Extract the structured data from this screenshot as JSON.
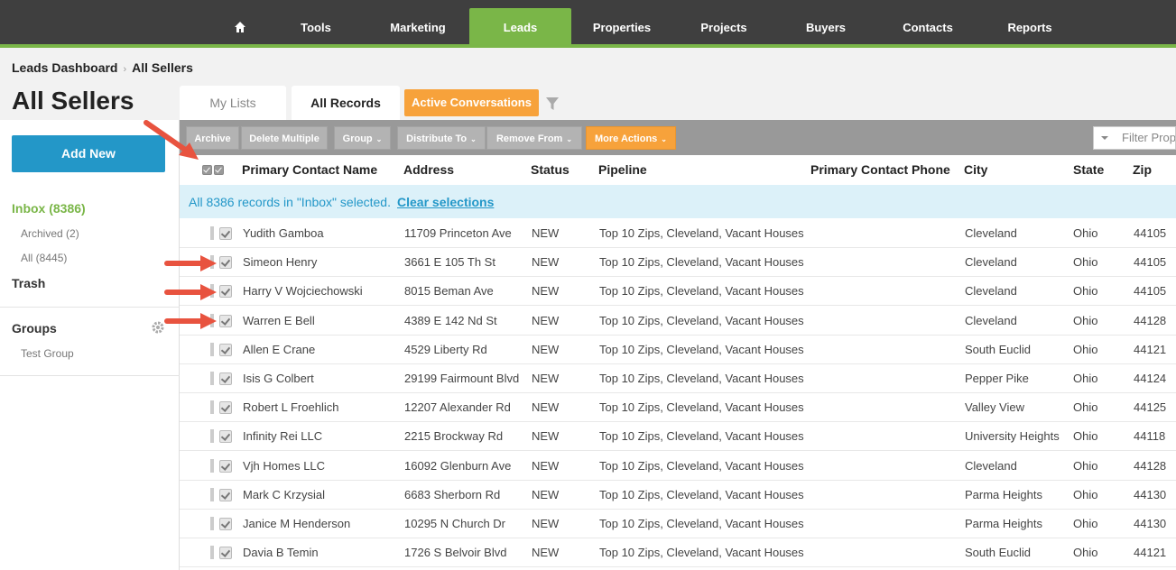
{
  "nav": {
    "items": [
      {
        "label": "",
        "icon": "home-icon"
      },
      {
        "label": "Tools"
      },
      {
        "label": "Marketing"
      },
      {
        "label": "Leads",
        "active": true
      },
      {
        "label": "Properties"
      },
      {
        "label": "Projects"
      },
      {
        "label": "Buyers"
      },
      {
        "label": "Contacts"
      },
      {
        "label": "Reports"
      }
    ]
  },
  "breadcrumb": {
    "parent": "Leads Dashboard",
    "current": "All Sellers"
  },
  "page_title": "All Sellers",
  "tabs": {
    "my_lists": "My Lists",
    "all_records": "All Records",
    "active_conversations": "Active Conversations"
  },
  "sidebar": {
    "add_new": "Add New",
    "inbox": "Inbox (8386)",
    "archived": "Archived (2)",
    "all": "All (8445)",
    "trash": "Trash",
    "groups": "Groups",
    "group_item": "Test Group"
  },
  "toolbar": {
    "archive": "Archive",
    "delete_multiple": "Delete Multiple",
    "group": "Group",
    "distribute_to": "Distribute To",
    "remove_from": "Remove From",
    "more_actions": "More Actions",
    "filter_placeholder": "Filter Prop"
  },
  "columns": {
    "name": "Primary Contact Name",
    "address": "Address",
    "status": "Status",
    "pipeline": "Pipeline",
    "phone": "Primary Contact Phone",
    "city": "City",
    "state": "State",
    "zip": "Zip"
  },
  "selection": {
    "message": "All 8386 records in \"Inbox\" selected.",
    "clear": "Clear selections"
  },
  "rows": [
    {
      "name": "Yudith Gamboa",
      "address": "11709 Princeton Ave",
      "status": "NEW",
      "pipeline": "Top 10 Zips, Cleveland, Vacant Houses",
      "city": "Cleveland",
      "state": "Ohio",
      "zip": "44105"
    },
    {
      "name": "Simeon Henry",
      "address": "3661 E 105 Th St",
      "status": "NEW",
      "pipeline": "Top 10 Zips, Cleveland, Vacant Houses",
      "city": "Cleveland",
      "state": "Ohio",
      "zip": "44105"
    },
    {
      "name": "Harry V Wojciechowski",
      "address": "8015 Beman Ave",
      "status": "NEW",
      "pipeline": "Top 10 Zips, Cleveland, Vacant Houses",
      "city": "Cleveland",
      "state": "Ohio",
      "zip": "44105"
    },
    {
      "name": "Warren E Bell",
      "address": "4389 E 142 Nd St",
      "status": "NEW",
      "pipeline": "Top 10 Zips, Cleveland, Vacant Houses",
      "city": "Cleveland",
      "state": "Ohio",
      "zip": "44128"
    },
    {
      "name": "Allen E Crane",
      "address": "4529 Liberty Rd",
      "status": "NEW",
      "pipeline": "Top 10 Zips, Cleveland, Vacant Houses",
      "city": "South Euclid",
      "state": "Ohio",
      "zip": "44121"
    },
    {
      "name": "Isis G Colbert",
      "address": "29199 Fairmount Blvd",
      "status": "NEW",
      "pipeline": "Top 10 Zips, Cleveland, Vacant Houses",
      "city": "Pepper Pike",
      "state": "Ohio",
      "zip": "44124"
    },
    {
      "name": "Robert L Froehlich",
      "address": "12207 Alexander Rd",
      "status": "NEW",
      "pipeline": "Top 10 Zips, Cleveland, Vacant Houses",
      "city": "Valley View",
      "state": "Ohio",
      "zip": "44125"
    },
    {
      "name": "Infinity Rei LLC",
      "address": "2215 Brockway Rd",
      "status": "NEW",
      "pipeline": "Top 10 Zips, Cleveland, Vacant Houses",
      "city": "University Heights",
      "state": "Ohio",
      "zip": "44118"
    },
    {
      "name": "Vjh Homes LLC",
      "address": "16092 Glenburn Ave",
      "status": "NEW",
      "pipeline": "Top 10 Zips, Cleveland, Vacant Houses",
      "city": "Cleveland",
      "state": "Ohio",
      "zip": "44128"
    },
    {
      "name": "Mark C Krzysial",
      "address": "6683 Sherborn Rd",
      "status": "NEW",
      "pipeline": "Top 10 Zips, Cleveland, Vacant Houses",
      "city": "Parma Heights",
      "state": "Ohio",
      "zip": "44130"
    },
    {
      "name": "Janice M Henderson",
      "address": "10295 N Church Dr",
      "status": "NEW",
      "pipeline": "Top 10 Zips, Cleveland, Vacant Houses",
      "city": "Parma Heights",
      "state": "Ohio",
      "zip": "44130"
    },
    {
      "name": "Davia B Temin",
      "address": "1726 S Belvoir Blvd",
      "status": "NEW",
      "pipeline": "Top 10 Zips, Cleveland, Vacant Houses",
      "city": "South Euclid",
      "state": "Ohio",
      "zip": "44121"
    }
  ],
  "colors": {
    "nav_bg": "#3f3f3f",
    "accent_green": "#7ab648",
    "blue": "#2397c8",
    "orange": "#f7a23b",
    "annotation_red": "#e8533f"
  }
}
